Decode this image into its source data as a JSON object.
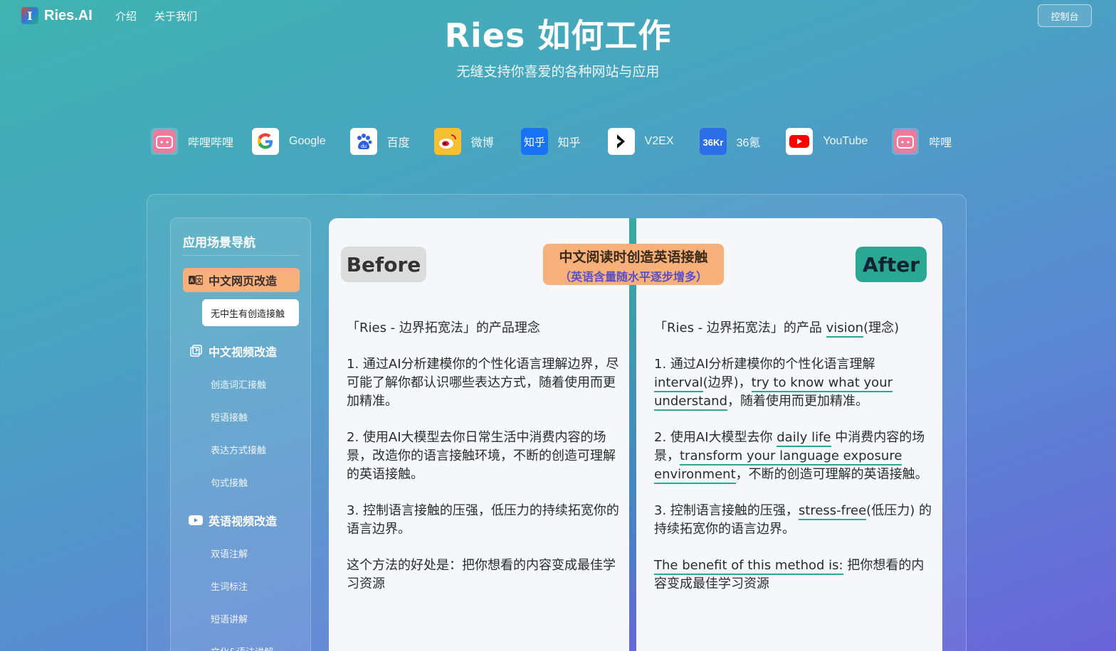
{
  "header": {
    "logo_letter": "I",
    "logo_text": "Ries.AI",
    "nav": [
      "介绍",
      "关于我们"
    ],
    "console_label": "控制台"
  },
  "hero": {
    "title": "Ries 如何工作",
    "subtitle": "无缝支持你喜爱的各种网站与应用"
  },
  "sites": [
    {
      "label": "哔哩哔哩",
      "icon": "bilibili-icon"
    },
    {
      "label": "Google",
      "icon": "google-icon"
    },
    {
      "label": "百度",
      "icon": "baidu-icon"
    },
    {
      "label": "微博",
      "icon": "weibo-icon"
    },
    {
      "label": "知乎",
      "icon": "zhihu-icon"
    },
    {
      "label": "V2EX",
      "icon": "v2ex-icon"
    },
    {
      "label": "36氪",
      "icon": "36kr-icon"
    },
    {
      "label": "YouTube",
      "icon": "youtube-icon"
    },
    {
      "label": "哔哩",
      "icon": "bilibili-icon"
    }
  ],
  "sidebar": {
    "title": "应用场景导航",
    "groups": [
      {
        "label": "中文网页改造",
        "icon": "translate-icon",
        "items": [
          "无中生有创造接触"
        ]
      },
      {
        "label": "中文视频改造",
        "icon": "video-icon",
        "items": [
          "创造词汇接触",
          "短语接触",
          "表达方式接触",
          "句式接触"
        ]
      },
      {
        "label": "英语视频改造",
        "icon": "youtube-play-icon",
        "items": [
          "双语注解",
          "生词标注",
          "短语讲解",
          "文化&语法讲解"
        ]
      }
    ]
  },
  "compare": {
    "before_label": "Before",
    "after_label": "After",
    "center_title": "中文阅读时创造英语接触",
    "center_sub": "（英语含量随水平逐步增多）",
    "before": {
      "p0": "「Ries - 边界拓宽法」的产品理念",
      "p1": "1. 通过AI分析建模你的个性化语言理解边界，尽可能了解你都认识哪些表达方式，随着使用而更加精准。",
      "p2": "2. 使用AI大模型去你日常生活中消费内容的场景，改造你的语言接触环境，不断的创造可理解的英语接触。",
      "p3": "3. 控制语言接触的压强，低压力的持续拓宽你的语言边界。",
      "p4": "这个方法的好处是：把你想看的内容变成最佳学习资源"
    },
    "after": {
      "p0a": "「Ries - 边界拓宽法」的产品 ",
      "p0h": "vision",
      "p0b": "(理念)",
      "p1a": "1. 通过AI分析建模你的个性化语言理解",
      "p1h1": "interval",
      "p1b": "(边界)，",
      "p1h2": "try to know what your understand",
      "p1c": "，随着使用而更加精准。",
      "p2a": "2. 使用AI大模型去你 ",
      "p2h1": "daily life",
      "p2b": " 中消费内容的场景，",
      "p2h2": "transform your language exposure environment",
      "p2c": "，不断的创造可理解的英语接触。",
      "p3a": "3. 控制语言接触的压强，",
      "p3h": "stress-free",
      "p3b": "(低压力) 的持续拓宽你的语言边界。",
      "p4h": "The benefit of this method is:",
      "p4b": " 把你想看的内容变成最佳学习资源"
    }
  }
}
